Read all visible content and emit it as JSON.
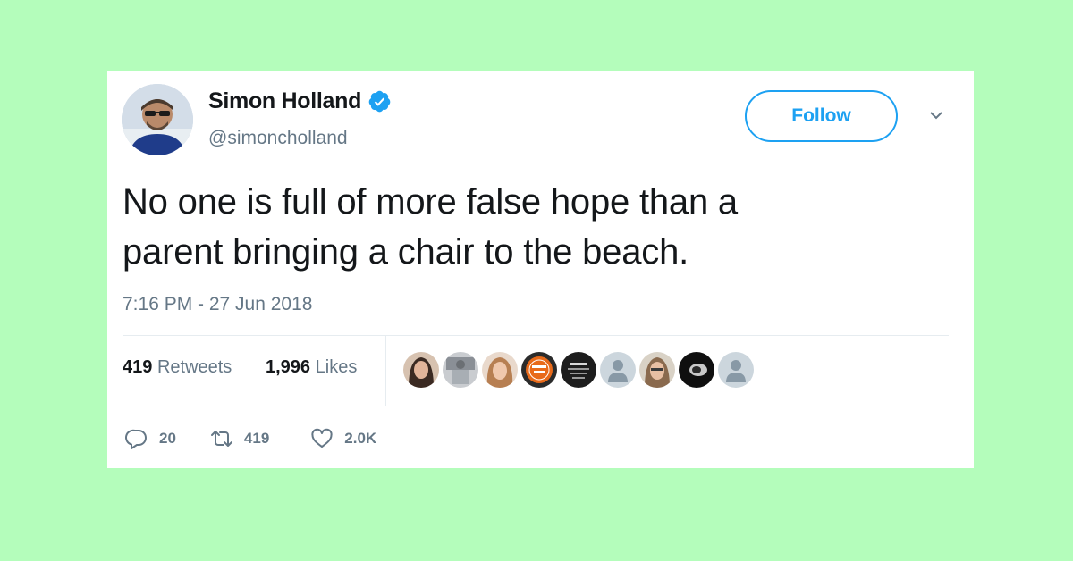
{
  "tweet": {
    "author": {
      "name": "Simon Holland",
      "handle": "@simoncholland",
      "verified": true
    },
    "follow_label": "Follow",
    "text_line1": "No one is full of more false hope than a",
    "text_line2": "parent bringing a chair to the beach.",
    "timestamp": "7:16 PM - 27 Jun 2018",
    "stats": {
      "retweets_count": "419",
      "retweets_label": "Retweets",
      "likes_count": "1,996",
      "likes_label": "Likes"
    },
    "actions": {
      "replies": "20",
      "retweets": "419",
      "likes": "2.0K"
    }
  },
  "colors": {
    "background": "#b4fdbb",
    "accent": "#1da1f2",
    "text": "#14171a",
    "secondary": "#657786"
  },
  "icons": [
    "verified-badge-icon",
    "chevron-down-icon",
    "reply-icon",
    "retweet-icon",
    "like-icon"
  ]
}
